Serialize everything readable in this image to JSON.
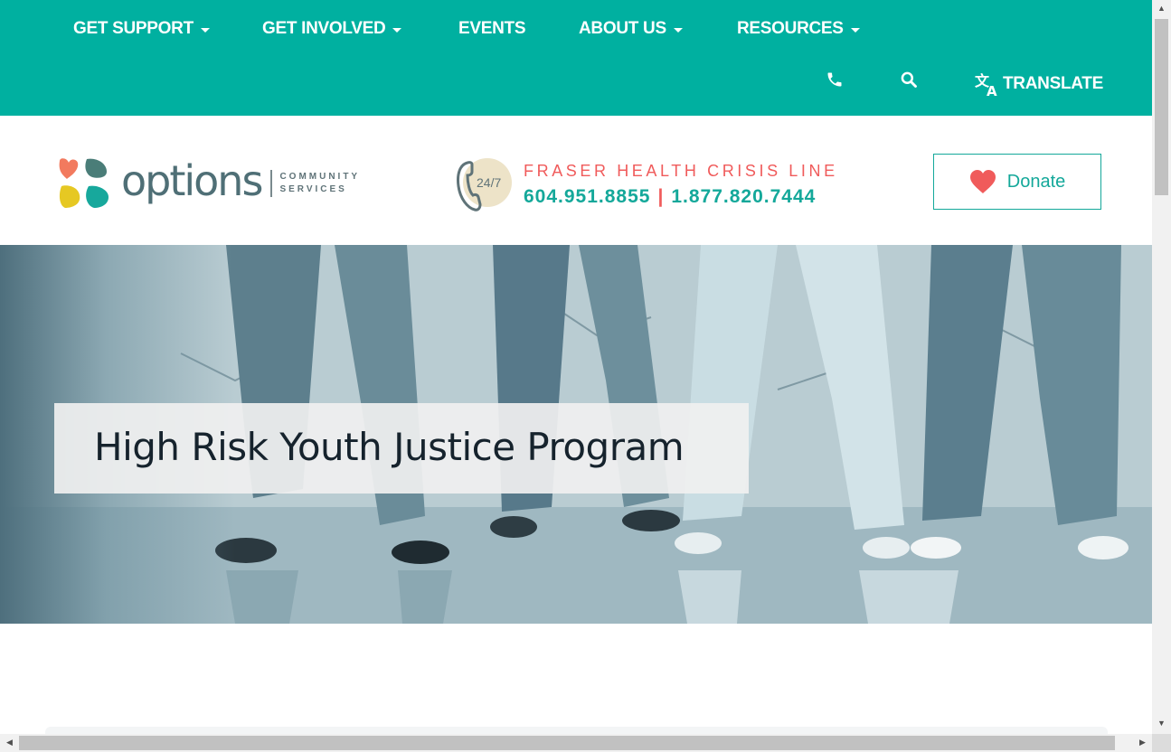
{
  "nav": {
    "items": [
      {
        "label": "GET SUPPORT",
        "has_dropdown": true
      },
      {
        "label": "GET INVOLVED",
        "has_dropdown": true
      },
      {
        "label": "EVENTS",
        "has_dropdown": false
      },
      {
        "label": "ABOUT US",
        "has_dropdown": true
      },
      {
        "label": "RESOURCES",
        "has_dropdown": true
      }
    ],
    "phone_icon": "phone-icon",
    "search_icon": "search-icon",
    "translate_icon": "translate-icon",
    "translate_label": "TRANSLATE"
  },
  "header": {
    "logo": {
      "word": "options",
      "sub_line1": "COMMUNITY",
      "sub_line2": "SERVICES"
    },
    "crisis": {
      "badge": "24/7",
      "title": "FRASER HEALTH CRISIS LINE",
      "phone1": "604.951.8855",
      "separator": "|",
      "phone2": "1.877.820.7444"
    },
    "donate_label": "Donate"
  },
  "hero": {
    "title": "High Risk Youth Justice Program"
  },
  "colors": {
    "teal": "#00b0a0",
    "teal_text": "#14a89a",
    "coral": "#f05b5b",
    "dark_text": "#16232d"
  }
}
